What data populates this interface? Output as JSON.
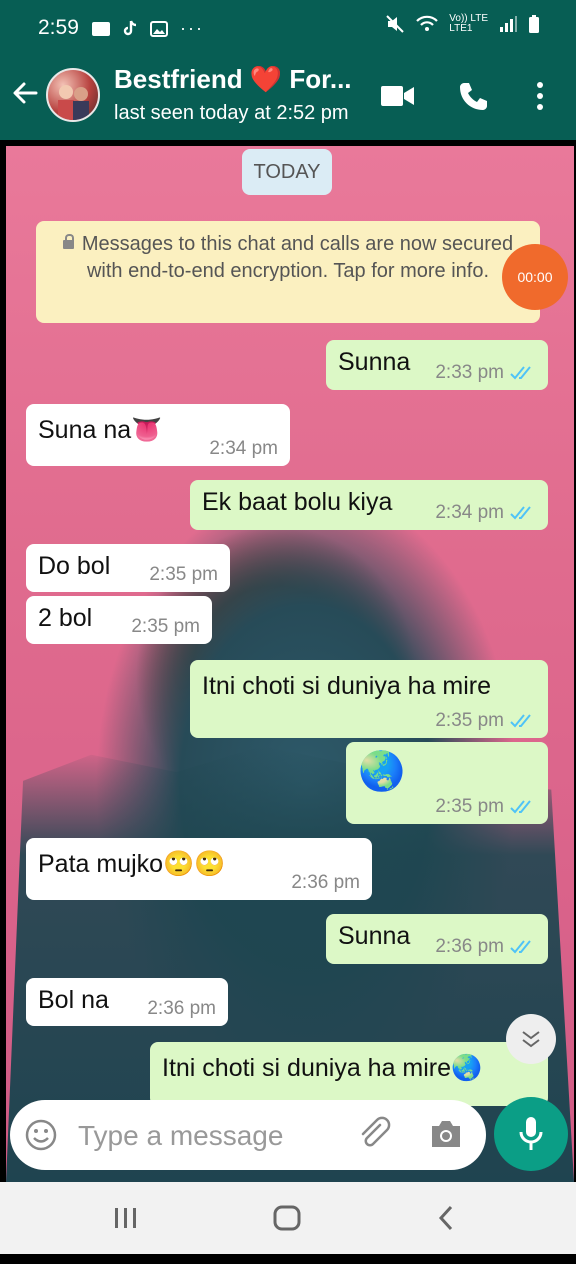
{
  "status_bar": {
    "time": "2:59",
    "more": "···",
    "network_labels": [
      "Vo)) LTE",
      "LTE1"
    ]
  },
  "header": {
    "contact_name": "Bestfriend ❤️ For...",
    "last_seen": "last seen today at 2:52 pm"
  },
  "chat": {
    "date_chip": "TODAY",
    "encryption_notice": "Messages to this chat and calls are now secured with end-to-end encryption. Tap for more info.",
    "messages": [
      {
        "dir": "out",
        "text": "Sunna",
        "time": "2:33 pm"
      },
      {
        "dir": "in",
        "text": "Suna na👅",
        "time": "2:34 pm"
      },
      {
        "dir": "out",
        "text": "Ek baat bolu kiya",
        "time": "2:34 pm"
      },
      {
        "dir": "in",
        "text": "Do bol",
        "time": "2:35 pm"
      },
      {
        "dir": "in",
        "text": "2 bol",
        "time": "2:35 pm"
      },
      {
        "dir": "out",
        "text": "Itni choti si duniya ha mire",
        "time": "2:35 pm"
      },
      {
        "dir": "out",
        "text": "🌏",
        "time": "2:35 pm"
      },
      {
        "dir": "in",
        "text": "Pata mujko🙄🙄",
        "time": "2:36 pm"
      },
      {
        "dir": "out",
        "text": "Sunna",
        "time": "2:36 pm"
      },
      {
        "dir": "in",
        "text": "Bol na",
        "time": "2:36 pm"
      },
      {
        "dir": "out",
        "text": "Itni choti si duniya ha mire🌏",
        "time": ""
      }
    ]
  },
  "overlay_timer": "00:00",
  "composer": {
    "placeholder": "Type a message"
  },
  "colors": {
    "header": "#075e54",
    "outgoing_bubble": "#dcf8c6",
    "incoming_bubble": "#ffffff",
    "read_tick": "#4fc3f7",
    "mic_button": "#0b9e86",
    "timer_overlay": "#f06a2c"
  },
  "icons": [
    "back-arrow-icon",
    "video-call-icon",
    "phone-icon",
    "more-vert-icon",
    "lock-icon",
    "double-tick-icon",
    "emoji-icon",
    "attach-icon",
    "camera-icon",
    "mic-icon",
    "chevron-down-icon",
    "recents-icon",
    "home-icon",
    "nav-back-icon"
  ]
}
